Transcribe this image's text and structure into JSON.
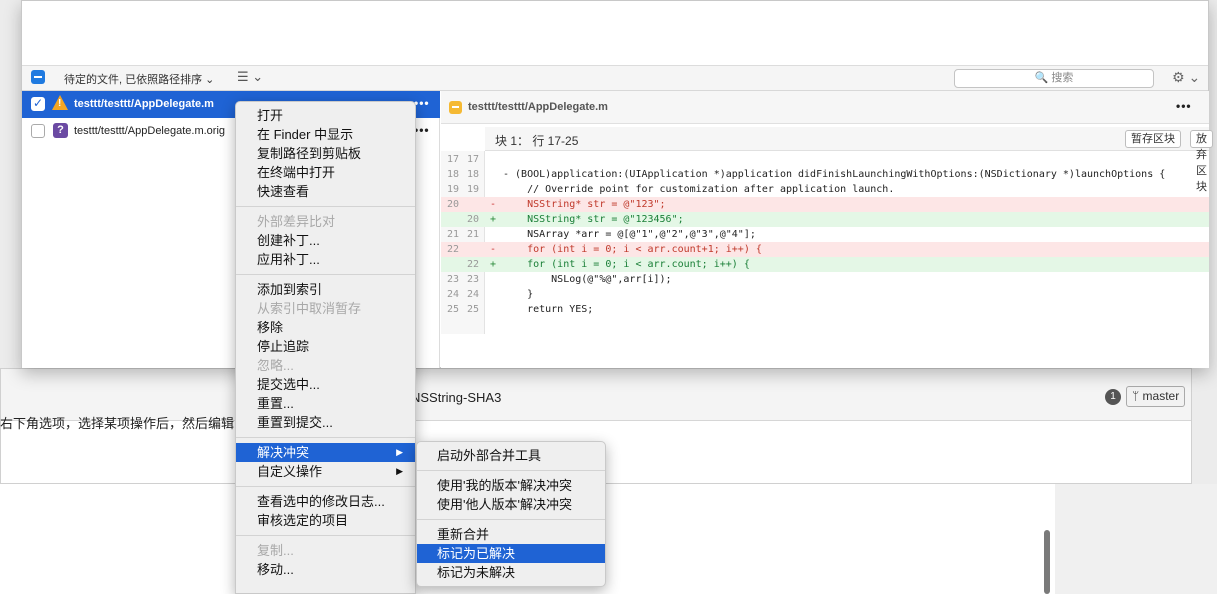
{
  "toolbar": {
    "sort_label": "待定的文件, 已依照路径排序 ⌄",
    "list_label": "☰ ⌄",
    "search_placeholder": "搜索",
    "search_text": "🔍 搜索",
    "gear": "⚙ ⌄"
  },
  "files": [
    {
      "name": "testtt/testtt/AppDelegate.m",
      "checked": true,
      "selected": true,
      "icon": "warning-icon",
      "more": "•••"
    },
    {
      "name": "testtt/testtt/AppDelegate.m.orig",
      "checked": false,
      "selected": false,
      "icon": "question-icon",
      "icon_text": "?",
      "more": "•••"
    }
  ],
  "diff": {
    "title": "testtt/testtt/AppDelegate.m",
    "more": "•••",
    "hunk_label": "块 1： 行 17-25",
    "stage_hunk": "暂存区块",
    "discard_hunk": "放弃区块",
    "lines": [
      {
        "l": "17",
        "r": "17",
        "t": " ",
        "s": "",
        "c": ""
      },
      {
        "l": "18",
        "r": "18",
        "t": " ",
        "s": "",
        "c": "- (BOOL)application:(UIApplication *)application didFinishLaunchingWithOptions:(NSDictionary *)launchOptions {"
      },
      {
        "l": "19",
        "r": "19",
        "t": " ",
        "s": "",
        "c": "    // Override point for customization after application launch."
      },
      {
        "l": "20",
        "r": "",
        "t": "del",
        "s": "-",
        "c": "    NSString* str = @\"123\";"
      },
      {
        "l": "",
        "r": "20",
        "t": "add",
        "s": "+",
        "c": "    NSString* str = @\"123456\";"
      },
      {
        "l": "21",
        "r": "21",
        "t": " ",
        "s": "",
        "c": "    NSArray *arr = @[@\"1\",@\"2\",@\"3\",@\"4\"];"
      },
      {
        "l": "22",
        "r": "",
        "t": "del",
        "s": "-",
        "c": "    for (int i = 0; i < arr.count+1; i++) {"
      },
      {
        "l": "",
        "r": "22",
        "t": "add",
        "s": "+",
        "c": "    for (int i = 0; i < arr.count; i++) {"
      },
      {
        "l": "23",
        "r": "23",
        "t": " ",
        "s": "",
        "c": "        NSLog(@\"%@\",arr[i]);"
      },
      {
        "l": "24",
        "r": "24",
        "t": " ",
        "s": "",
        "c": "    }"
      },
      {
        "l": "25",
        "r": "25",
        "t": " ",
        "s": "",
        "c": "    return YES;"
      }
    ]
  },
  "background": {
    "title": "NSString-SHA3",
    "left_text": "右下角选项，选择某项操作后，然后编辑",
    "count": "1",
    "branch": "ᛘ master"
  },
  "menu": {
    "groups": [
      [
        {
          "label": "打开",
          "disabled": false
        },
        {
          "label": "在 Finder 中显示",
          "disabled": false
        },
        {
          "label": "复制路径到剪贴板",
          "disabled": false
        },
        {
          "label": "在终端中打开",
          "disabled": false
        },
        {
          "label": "快速查看",
          "disabled": false
        }
      ],
      [
        {
          "label": "外部差异比对",
          "disabled": true
        },
        {
          "label": "创建补丁...",
          "disabled": false
        },
        {
          "label": "应用补丁...",
          "disabled": false
        }
      ],
      [
        {
          "label": "添加到索引",
          "disabled": false
        },
        {
          "label": "从索引中取消暂存",
          "disabled": true
        },
        {
          "label": "移除",
          "disabled": false
        },
        {
          "label": "停止追踪",
          "disabled": false
        },
        {
          "label": "忽略...",
          "disabled": true
        },
        {
          "label": "提交选中...",
          "disabled": false
        },
        {
          "label": "重置...",
          "disabled": false
        },
        {
          "label": "重置到提交...",
          "disabled": false
        }
      ],
      [
        {
          "label": "解决冲突",
          "disabled": false,
          "highlighted": true,
          "submenu": true
        },
        {
          "label": "自定义操作",
          "disabled": false,
          "submenu": true
        }
      ],
      [
        {
          "label": "查看选中的修改日志...",
          "disabled": false
        },
        {
          "label": "审核选定的项目",
          "disabled": false
        }
      ],
      [
        {
          "label": "复制...",
          "disabled": true
        },
        {
          "label": "移动...",
          "disabled": false
        }
      ]
    ],
    "arrow": "▶"
  },
  "submenu": {
    "groups": [
      [
        {
          "label": "启动外部合并工具"
        }
      ],
      [
        {
          "label": "使用'我的版本'解决冲突"
        },
        {
          "label": "使用'他人版本'解决冲突"
        }
      ],
      [
        {
          "label": "重新合并"
        },
        {
          "label": "标记为已解决",
          "highlighted": true
        },
        {
          "label": "标记为未解决"
        }
      ]
    ]
  }
}
